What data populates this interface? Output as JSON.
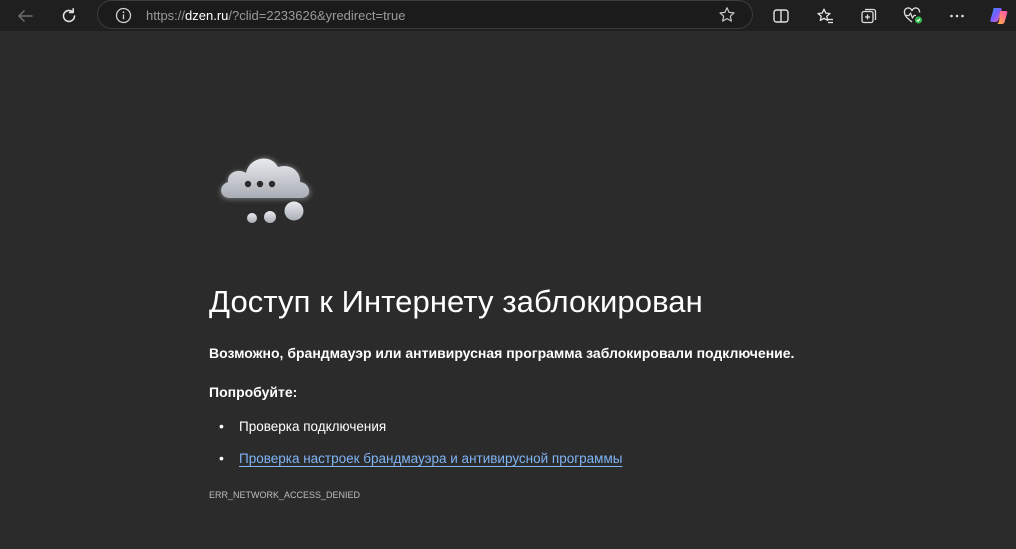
{
  "browser": {
    "url_protocol": "https://",
    "url_host": "dzen.ru",
    "url_rest": "/?clid=2233626&yredirect=true",
    "icons": {
      "back": "back-arrow-icon",
      "reload": "reload-icon",
      "site_info": "info-icon",
      "favorite": "star-icon",
      "split_screen": "split-screen-icon",
      "favorites": "favorites-icon",
      "collections": "collections-icon",
      "browser_essentials": "heartbeat-icon",
      "more": "more-icon",
      "copilot": "copilot-icon"
    }
  },
  "error_page": {
    "title": "Доступ к Интернету заблокирован",
    "subtitle": "Возможно, брандмауэр или антивирусная программа заблокировали подключение.",
    "try_label": "Попробуйте:",
    "suggestions": [
      "Проверка подключения",
      "Проверка настроек брандмауэра и антивирусной программы"
    ],
    "error_code": "ERR_NETWORK_ACCESS_DENIED"
  },
  "colors": {
    "page_bg": "#2b2b2b",
    "toolbar_bg": "#1f1f1f",
    "link": "#7fb4f5",
    "status_green": "#2db34a"
  }
}
